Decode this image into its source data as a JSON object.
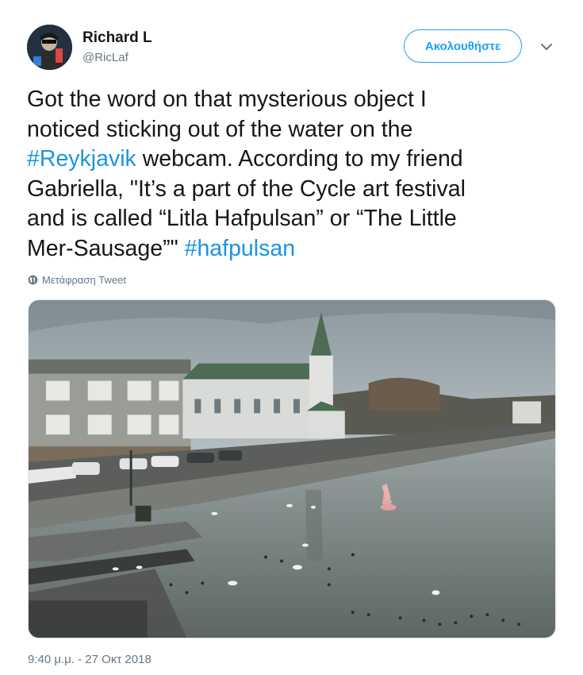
{
  "author": {
    "name": "Richard L",
    "handle": "@RicLaf",
    "avatar_icon": "user-avatar"
  },
  "follow_button": {
    "label": "Ακολουθήστε",
    "color": "#1da1f2"
  },
  "menu_icon": "chevron-down-icon",
  "tweet": {
    "lines": [
      {
        "text": "Got the word on that mysterious object I"
      },
      {
        "text": "noticed sticking out of the water on the"
      },
      {
        "hashtag": "#Reykjavik",
        "text": " webcam. According to my friend"
      },
      {
        "text": "Gabriella, \"It’s a part of the Cycle art festival"
      },
      {
        "text": "and is called “Litla Hafpulsan” or “The Little"
      },
      {
        "text": "Mer-Sausage”\" ",
        "hashtag": "#hafpulsan"
      }
    ],
    "hashtag_color": "#1b95e0"
  },
  "translate_link": {
    "label": "Μετάφραση Tweet",
    "icon": "globe-icon"
  },
  "media": {
    "type": "photo",
    "description_icon": "webcam-photo"
  },
  "timestamp": "9:40 μ.μ. - 27 Οκτ 2018"
}
